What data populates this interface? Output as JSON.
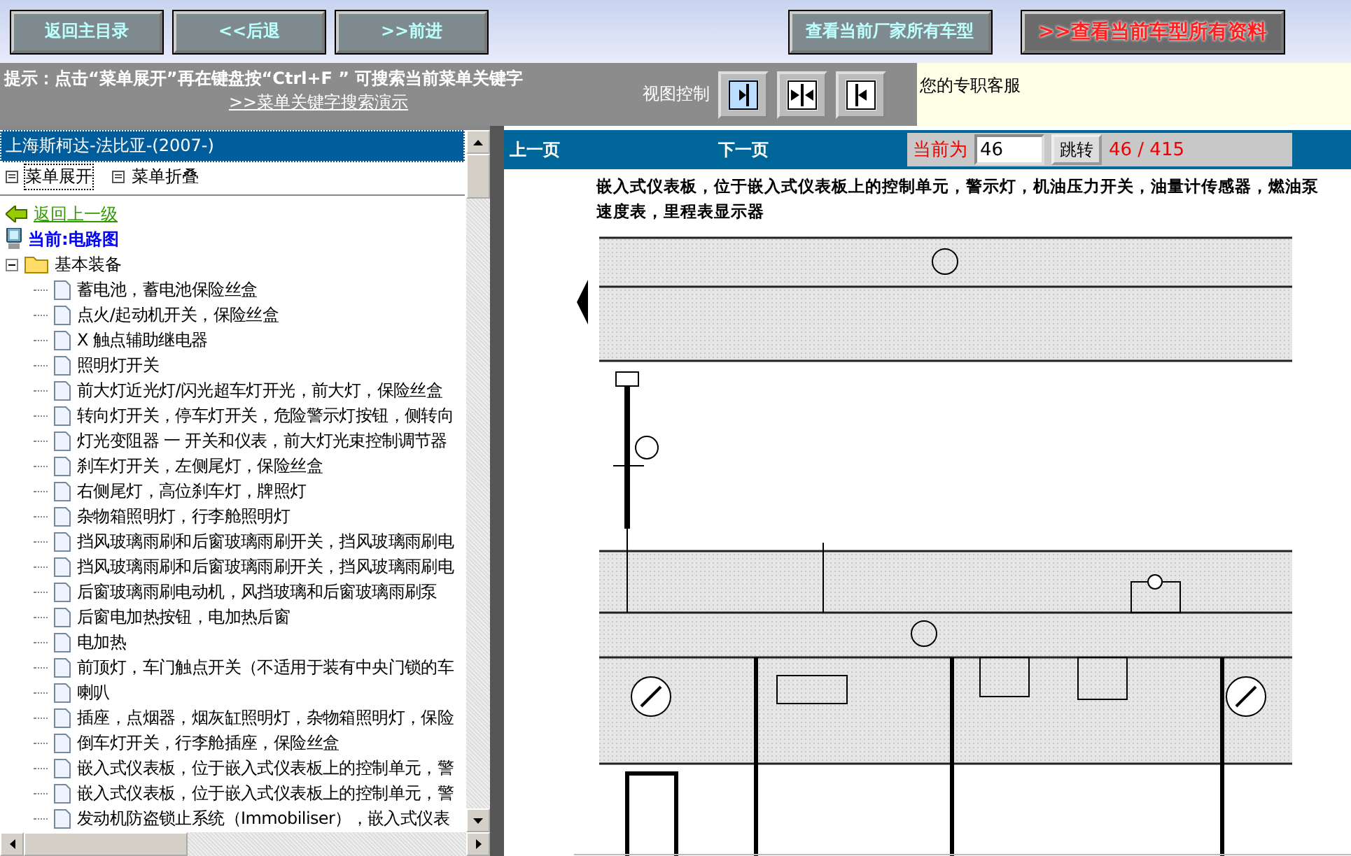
{
  "toolbar": {
    "nav_buttons": [
      {
        "label": "返回主目录"
      },
      {
        "label": "<<后退"
      },
      {
        "label": ">>前进"
      }
    ],
    "maker_button": {
      "label": "查看当前厂家所有车型"
    },
    "model_button": {
      "label": ">>查看当前车型所有资料"
    }
  },
  "hint_bar": {
    "text": "提示：点击“菜单展开”再在键盘按“Ctrl+F ” 可搜索当前菜单关键字",
    "link": ">>菜单关键字搜索演示"
  },
  "view_control": {
    "label": "视图控制",
    "buttons": [
      {
        "kind": "right",
        "selected": true
      },
      {
        "kind": "both",
        "selected": false
      },
      {
        "kind": "left",
        "selected": false
      }
    ]
  },
  "service_text": "您的专职客服",
  "sidebar": {
    "title": "上海斯柯达-法比亚-(2007-)",
    "menu_actions": [
      {
        "label": "菜单展开",
        "selected": true
      },
      {
        "label": "菜单折叠",
        "selected": false
      }
    ],
    "back_link": "返回上一级",
    "current": "当前:电路图",
    "tree": {
      "label": "基本装备",
      "expanded": true,
      "children": [
        {
          "label": "蓄电池，蓄电池保险丝盒"
        },
        {
          "label": "点火/起动机开关，保险丝盒"
        },
        {
          "label": "X 触点辅助继电器"
        },
        {
          "label": "照明灯开关"
        },
        {
          "label": "前大灯近光灯/闪光超车灯开光，前大灯，保险丝盒"
        },
        {
          "label": "转向灯开关，停车灯开关，危险警示灯按钮，侧转向"
        },
        {
          "label": "灯光变阻器 一 开关和仪表，前大灯光束控制调节器"
        },
        {
          "label": "刹车灯开关，左侧尾灯，保险丝盒"
        },
        {
          "label": "右侧尾灯，高位刹车灯，牌照灯"
        },
        {
          "label": "杂物箱照明灯，行李舱照明灯"
        },
        {
          "label": "挡风玻璃雨刷和后窗玻璃雨刷开关，挡风玻璃雨刷电"
        },
        {
          "label": "挡风玻璃雨刷和后窗玻璃雨刷开关，挡风玻璃雨刷电"
        },
        {
          "label": "后窗玻璃雨刷电动机，风挡玻璃和后窗玻璃雨刷泵"
        },
        {
          "label": "后窗电加热按钮，电加热后窗"
        },
        {
          "label": "电加热"
        },
        {
          "label": "前顶灯，车门触点开关（不适用于装有中央门锁的车"
        },
        {
          "label": "喇叭"
        },
        {
          "label": "插座，点烟器，烟灰缸照明灯，杂物箱照明灯，保险"
        },
        {
          "label": "倒车灯开关，行李舱插座，保险丝盒"
        },
        {
          "label": "嵌入式仪表板，位于嵌入式仪表板上的控制单元，警"
        },
        {
          "label": "嵌入式仪表板，位于嵌入式仪表板上的控制单元，警"
        },
        {
          "label": "发动机防盗锁止系统（Immobiliser），嵌入式仪表"
        }
      ]
    }
  },
  "pager": {
    "prev": "上一页",
    "next": "下一页",
    "current_label": "当前为",
    "page_value": "46",
    "jump_button": "跳转",
    "page_count": "46 / 415"
  },
  "document": {
    "description": "嵌入式仪表板，位于嵌入式仪表板上的控制单元，警示灯，机油压力开关，油量计传感器，燃油泵",
    "description_2": "速度表，里程表显示器"
  }
}
